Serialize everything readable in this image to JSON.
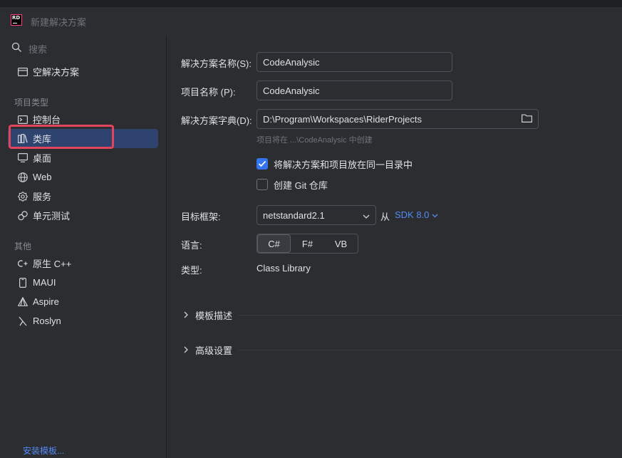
{
  "window": {
    "logo_text": "RD",
    "title": "新建解决方案"
  },
  "sidebar": {
    "search_placeholder": "搜索",
    "empty_solution": "空解决方案",
    "section_project_types": "项目类型",
    "project_types": [
      {
        "label": "控制台",
        "icon": "console-icon"
      },
      {
        "label": "类库",
        "icon": "library-icon",
        "selected": true
      },
      {
        "label": "桌面",
        "icon": "desktop-icon"
      },
      {
        "label": "Web",
        "icon": "globe-icon"
      },
      {
        "label": "服务",
        "icon": "gear-icon"
      },
      {
        "label": "单元测试",
        "icon": "unit-test-icon"
      }
    ],
    "section_other": "其他",
    "other_types": [
      {
        "label": "原生 C++",
        "icon": "cpp-icon"
      },
      {
        "label": "MAUI",
        "icon": "mobile-icon"
      },
      {
        "label": "Aspire",
        "icon": "aspire-icon"
      },
      {
        "label": "Roslyn",
        "icon": "roslyn-icon"
      }
    ],
    "install_templates": "安装模板..."
  },
  "form": {
    "solution_name_label": "解决方案名称(S):",
    "solution_name_value": "CodeAnalysic",
    "project_name_label": "项目名称 (P):",
    "project_name_value": "CodeAnalysic",
    "solution_dir_label": "解决方案字典(D):",
    "solution_dir_value": "D:\\Program\\Workspaces\\RiderProjects",
    "hint": "项目将在 ...\\CodeAnalysic 中创建",
    "same_dir_label": "将解决方案和项目放在同一目录中",
    "same_dir_checked": true,
    "git_label": "创建 Git 仓库",
    "git_checked": false,
    "framework_label": "目标框架:",
    "framework_value": "netstandard2.1",
    "from_label": "从",
    "sdk_value": "SDK 8.0",
    "language_label": "语言:",
    "languages": [
      "C#",
      "F#",
      "VB"
    ],
    "selected_language": "C#",
    "type_label": "类型:",
    "type_value": "Class Library",
    "template_desc_label": "模板描述",
    "advanced_label": "高级设置"
  },
  "colors": {
    "accent": "#3574f0",
    "link": "#548af7",
    "selected_bg": "#2e436e",
    "annotation_box": "#e2445c"
  }
}
